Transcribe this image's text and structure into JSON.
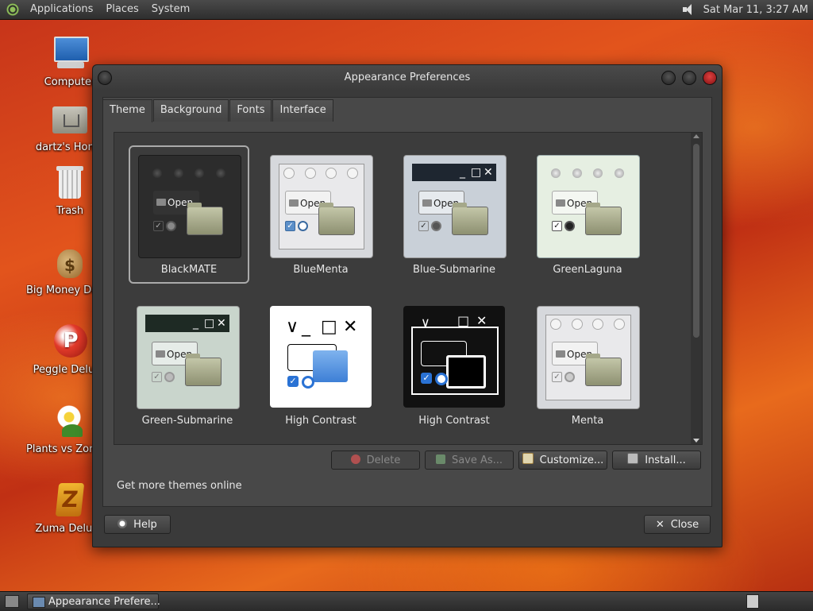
{
  "top_panel": {
    "menus": [
      "Applications",
      "Places",
      "System"
    ],
    "clock": "Sat Mar 11,  3:27 AM"
  },
  "desktop_icons": [
    {
      "label": "Computer",
      "icon": "computer-icon"
    },
    {
      "label": "dartz's Home",
      "icon": "home-folder-icon"
    },
    {
      "label": "Trash",
      "icon": "trash-icon"
    },
    {
      "label": "Big Money Deluxe",
      "icon": "big-money-icon"
    },
    {
      "label": "Peggle Deluxe",
      "icon": "peggle-icon"
    },
    {
      "label": "Plants vs Zombies",
      "icon": "plants-vs-zombies-icon"
    },
    {
      "label": "Zuma Deluxe",
      "icon": "zuma-icon"
    }
  ],
  "window": {
    "title": "Appearance Preferences",
    "tabs": [
      "Theme",
      "Background",
      "Fonts",
      "Interface"
    ],
    "active_tab": "Theme",
    "themes": [
      {
        "name": "BlackMATE",
        "selected": true
      },
      {
        "name": "BlueMenta",
        "selected": false
      },
      {
        "name": "Blue-Submarine",
        "selected": false
      },
      {
        "name": "GreenLaguna",
        "selected": false
      },
      {
        "name": "Green-Submarine",
        "selected": false
      },
      {
        "name": "High Contrast",
        "selected": false
      },
      {
        "name": "High Contrast",
        "selected": false
      },
      {
        "name": "Menta",
        "selected": false
      }
    ],
    "preview_open_label": "Open",
    "buttons": {
      "delete": "Delete",
      "save_as": "Save As...",
      "customize": "Customize...",
      "install": "Install...",
      "help": "Help",
      "close": "Close"
    },
    "more_themes_link": "Get more themes online"
  },
  "taskbar": {
    "task_label": "Appearance Prefere..."
  },
  "colors": {
    "window_bg": "#3a3a3a",
    "panel_bg": "#2e2e2e",
    "wallpaper_primary": "#c5321a",
    "wallpaper_accent": "#e86a1c"
  }
}
